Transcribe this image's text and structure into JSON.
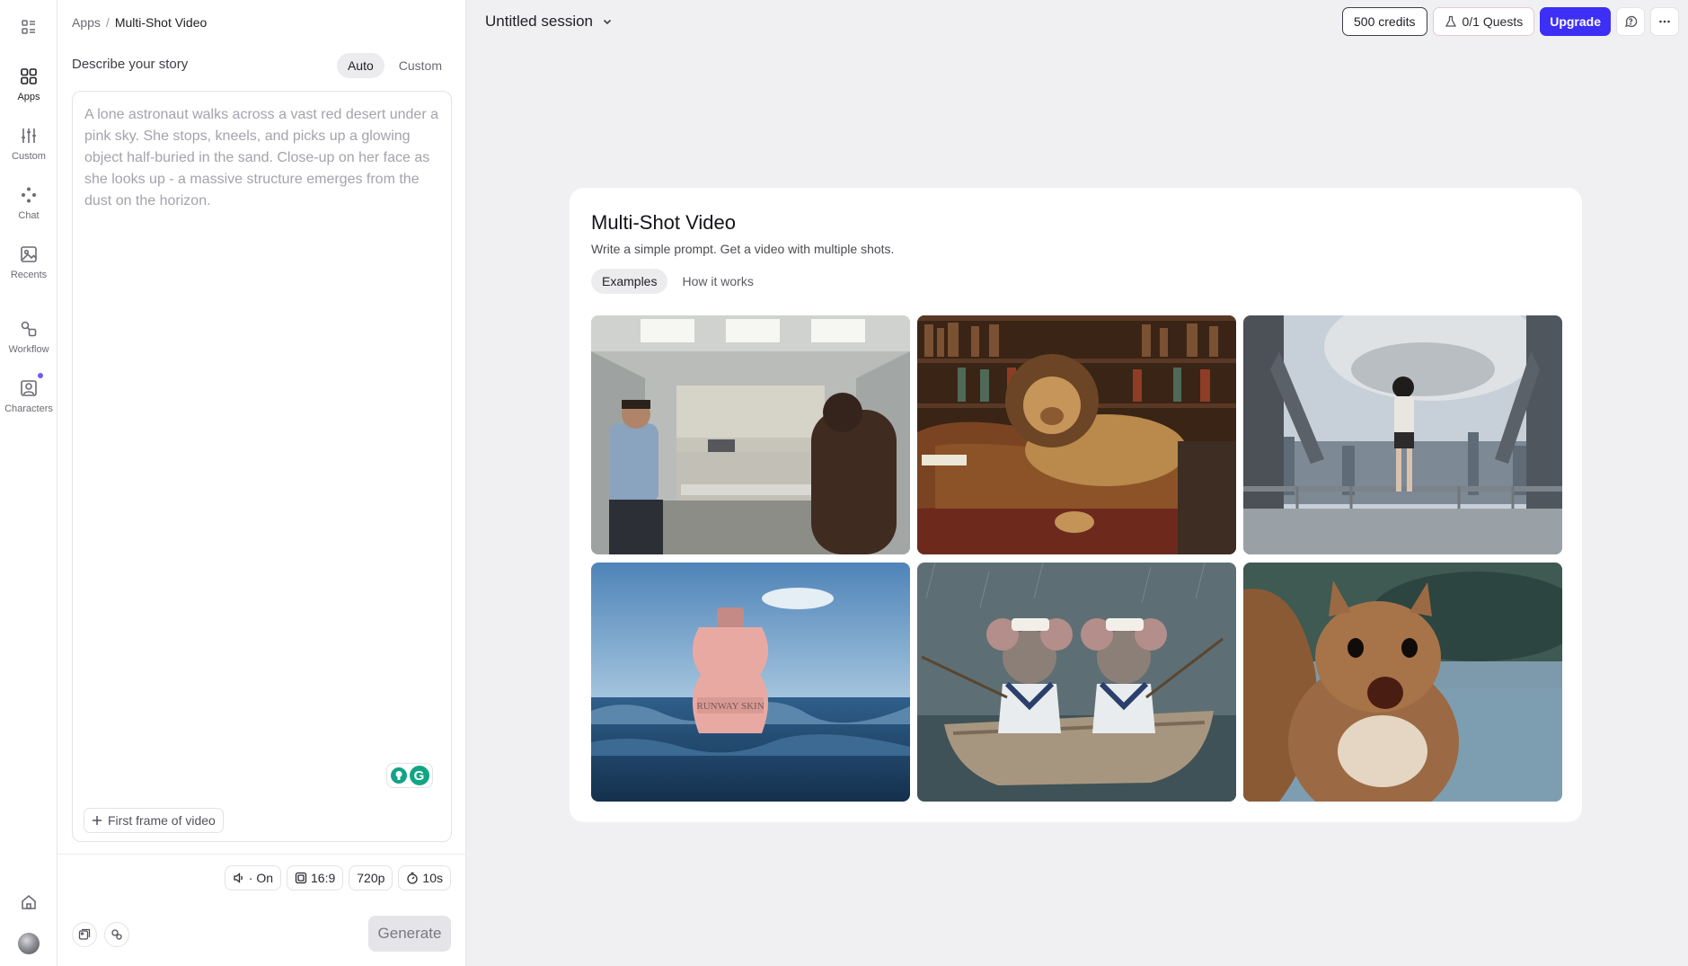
{
  "rail": {
    "items": [
      {
        "label": "Apps",
        "icon": "apps-icon"
      },
      {
        "label": "Custom",
        "icon": "sliders-icon"
      },
      {
        "label": "Chat",
        "icon": "chat-icon"
      },
      {
        "label": "Recents",
        "icon": "recents-icon"
      },
      {
        "label": "Workflow",
        "icon": "workflow-icon"
      },
      {
        "label": "Characters",
        "icon": "characters-icon"
      }
    ]
  },
  "breadcrumb": {
    "root": "Apps",
    "separator": "/",
    "current": "Multi-Shot Video"
  },
  "story": {
    "title": "Describe your story",
    "modes": [
      "Auto",
      "Custom"
    ],
    "active_mode": "Auto",
    "placeholder": "A lone astronaut walks across a vast red desert under a pink sky. She stops, kneels, and picks up a glowing object half-buried in the sand. Close-up on her face as she looks up - a massive structure emerges from the dust on the horizon.",
    "first_frame_label": "First frame of video"
  },
  "options": {
    "audio": "· On",
    "aspect": "16:9",
    "resolution": "720p",
    "duration": "10s"
  },
  "generate_label": "Generate",
  "session": {
    "title": "Untitled session"
  },
  "topbar": {
    "credits": "500 credits",
    "quests": "0/1 Quests",
    "upgrade": "Upgrade"
  },
  "card": {
    "title": "Multi-Shot Video",
    "subtitle": "Write a simple prompt. Get a video with multiple shots.",
    "tabs": [
      "Examples",
      "How it works"
    ],
    "active_tab": "Examples",
    "examples": [
      {
        "name": "office-break-room-example"
      },
      {
        "name": "lion-on-sofa-example"
      },
      {
        "name": "robot-city-example"
      },
      {
        "name": "perfume-bottle-ocean-example",
        "text": "RUNWAY SKIN"
      },
      {
        "name": "sailor-mice-boat-example"
      },
      {
        "name": "surprised-squirrel-example"
      }
    ]
  },
  "colors": {
    "accent": "#3d2ff5",
    "notification_dot": "#6e5cf6",
    "grammarly": "#11a683"
  }
}
